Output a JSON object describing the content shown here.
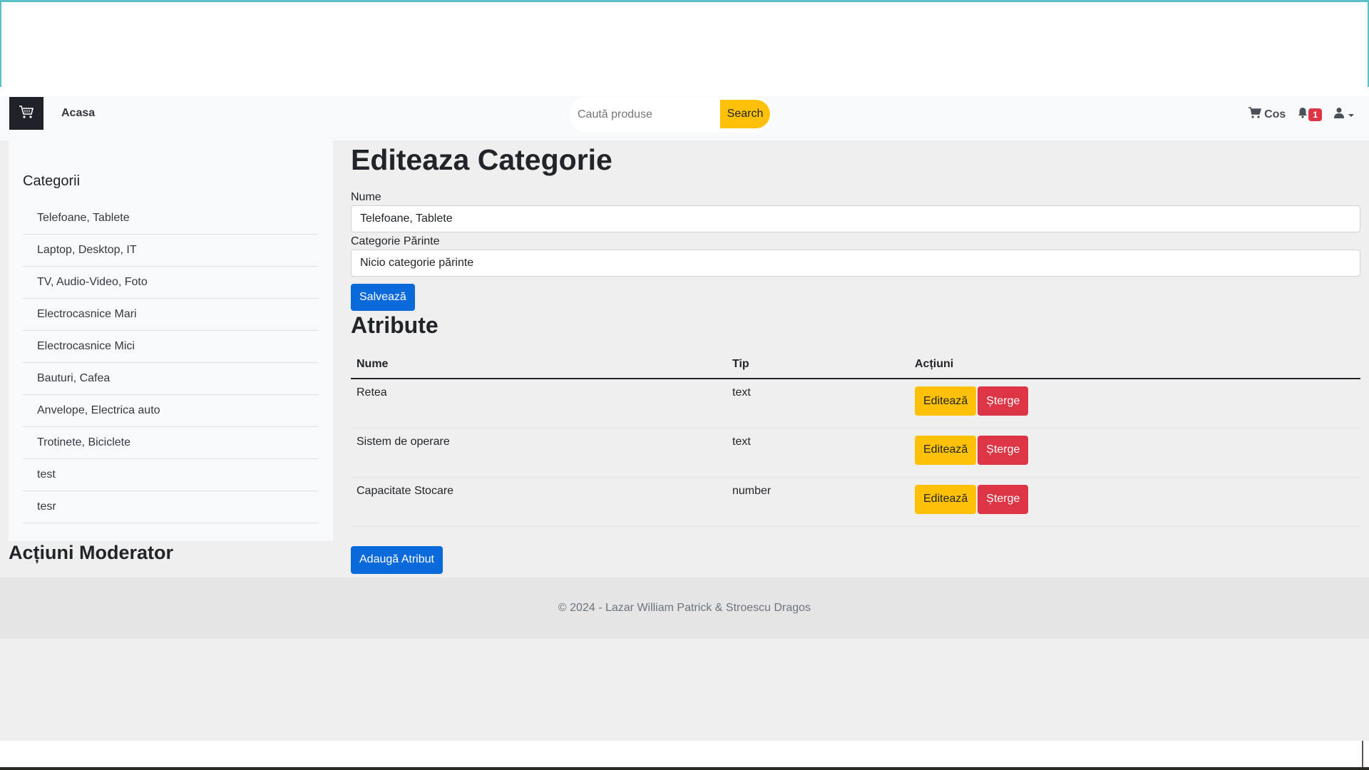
{
  "navbar": {
    "home_label": "Acasa",
    "search_placeholder": "Caută produse",
    "search_button": "Search",
    "cart_label": "Cos",
    "notification_count": "1"
  },
  "sidebar": {
    "title": "Categorii",
    "items": [
      "Telefoane, Tablete",
      "Laptop, Desktop, IT",
      "TV, Audio-Video, Foto",
      "Electrocasnice Mari",
      "Electrocasnice Mici",
      "Bauturi, Cafea",
      "Anvelope, Electrica auto",
      "Trotinete, Biciclete",
      "test",
      "tesr"
    ],
    "moderator_title": "Acțiuni Moderator"
  },
  "form": {
    "title": "Editeaza Categorie",
    "name_label": "Nume",
    "name_value": "Telefoane, Tablete",
    "parent_label": "Categorie Părinte",
    "parent_value": "Nicio categorie părinte",
    "save_button": "Salvează"
  },
  "attributes": {
    "title": "Atribute",
    "columns": [
      "Nume",
      "Tip",
      "Acțiuni"
    ],
    "rows": [
      {
        "name": "Retea",
        "type": "text"
      },
      {
        "name": "Sistem de operare",
        "type": "text"
      },
      {
        "name": "Capacitate Stocare",
        "type": "number"
      }
    ],
    "edit_button": "Editează",
    "delete_button": "Șterge",
    "add_button": "Adaugă Atribut"
  },
  "footer": {
    "text": "© 2024 - Lazar William Patrick & Stroescu Dragos"
  },
  "colors": {
    "primary": "#0b6ad9",
    "warning": "#ffc107",
    "danger": "#dc3545"
  },
  "icons": {
    "brand": "shopping-cart-icon",
    "cart": "cart-icon",
    "notification": "bell-icon",
    "user": "user-icon",
    "caret": "chevron-down-icon"
  }
}
